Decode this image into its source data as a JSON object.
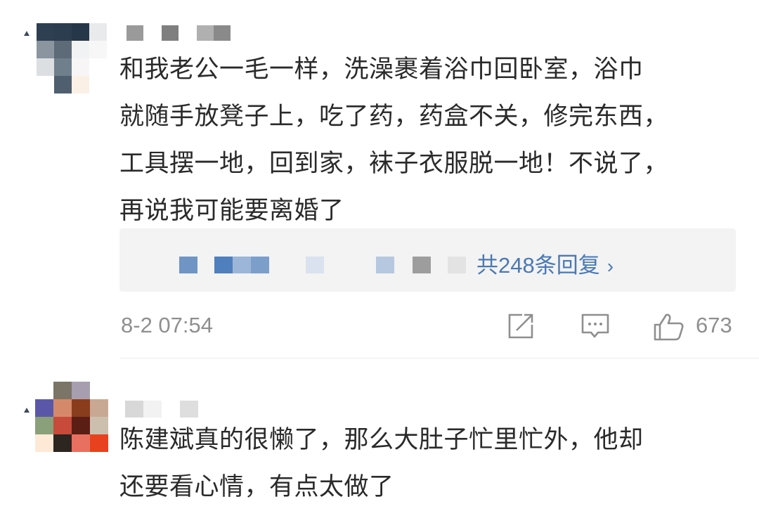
{
  "comments": [
    {
      "text_lines": [
        "和我老公一毛一样，洗澡裹着浴巾回卧室，浴巾",
        "就随手放凳子上，吃了药，药盒不关，修完东西，",
        "工具摆一地，回到家，袜子衣服脱一地！不说了，",
        "再说我可能要离婚了"
      ],
      "reply_link": "共248条回复",
      "reply_chevron": "›",
      "timestamp": "8-2 07:54",
      "like_count": "673"
    },
    {
      "text_lines": [
        "陈建斌真的很懒了，那么大肚子忙里忙外，他却",
        "还要看心情，有点太做了"
      ]
    }
  ],
  "icons": {
    "share": "share-icon",
    "comment": "comment-icon",
    "like": "thumbs-up-icon"
  },
  "colors": {
    "link": "#4a79b4",
    "meta": "#8f8f8f",
    "text": "#2a2a2a",
    "reply_bg": "#f3f3f3"
  }
}
